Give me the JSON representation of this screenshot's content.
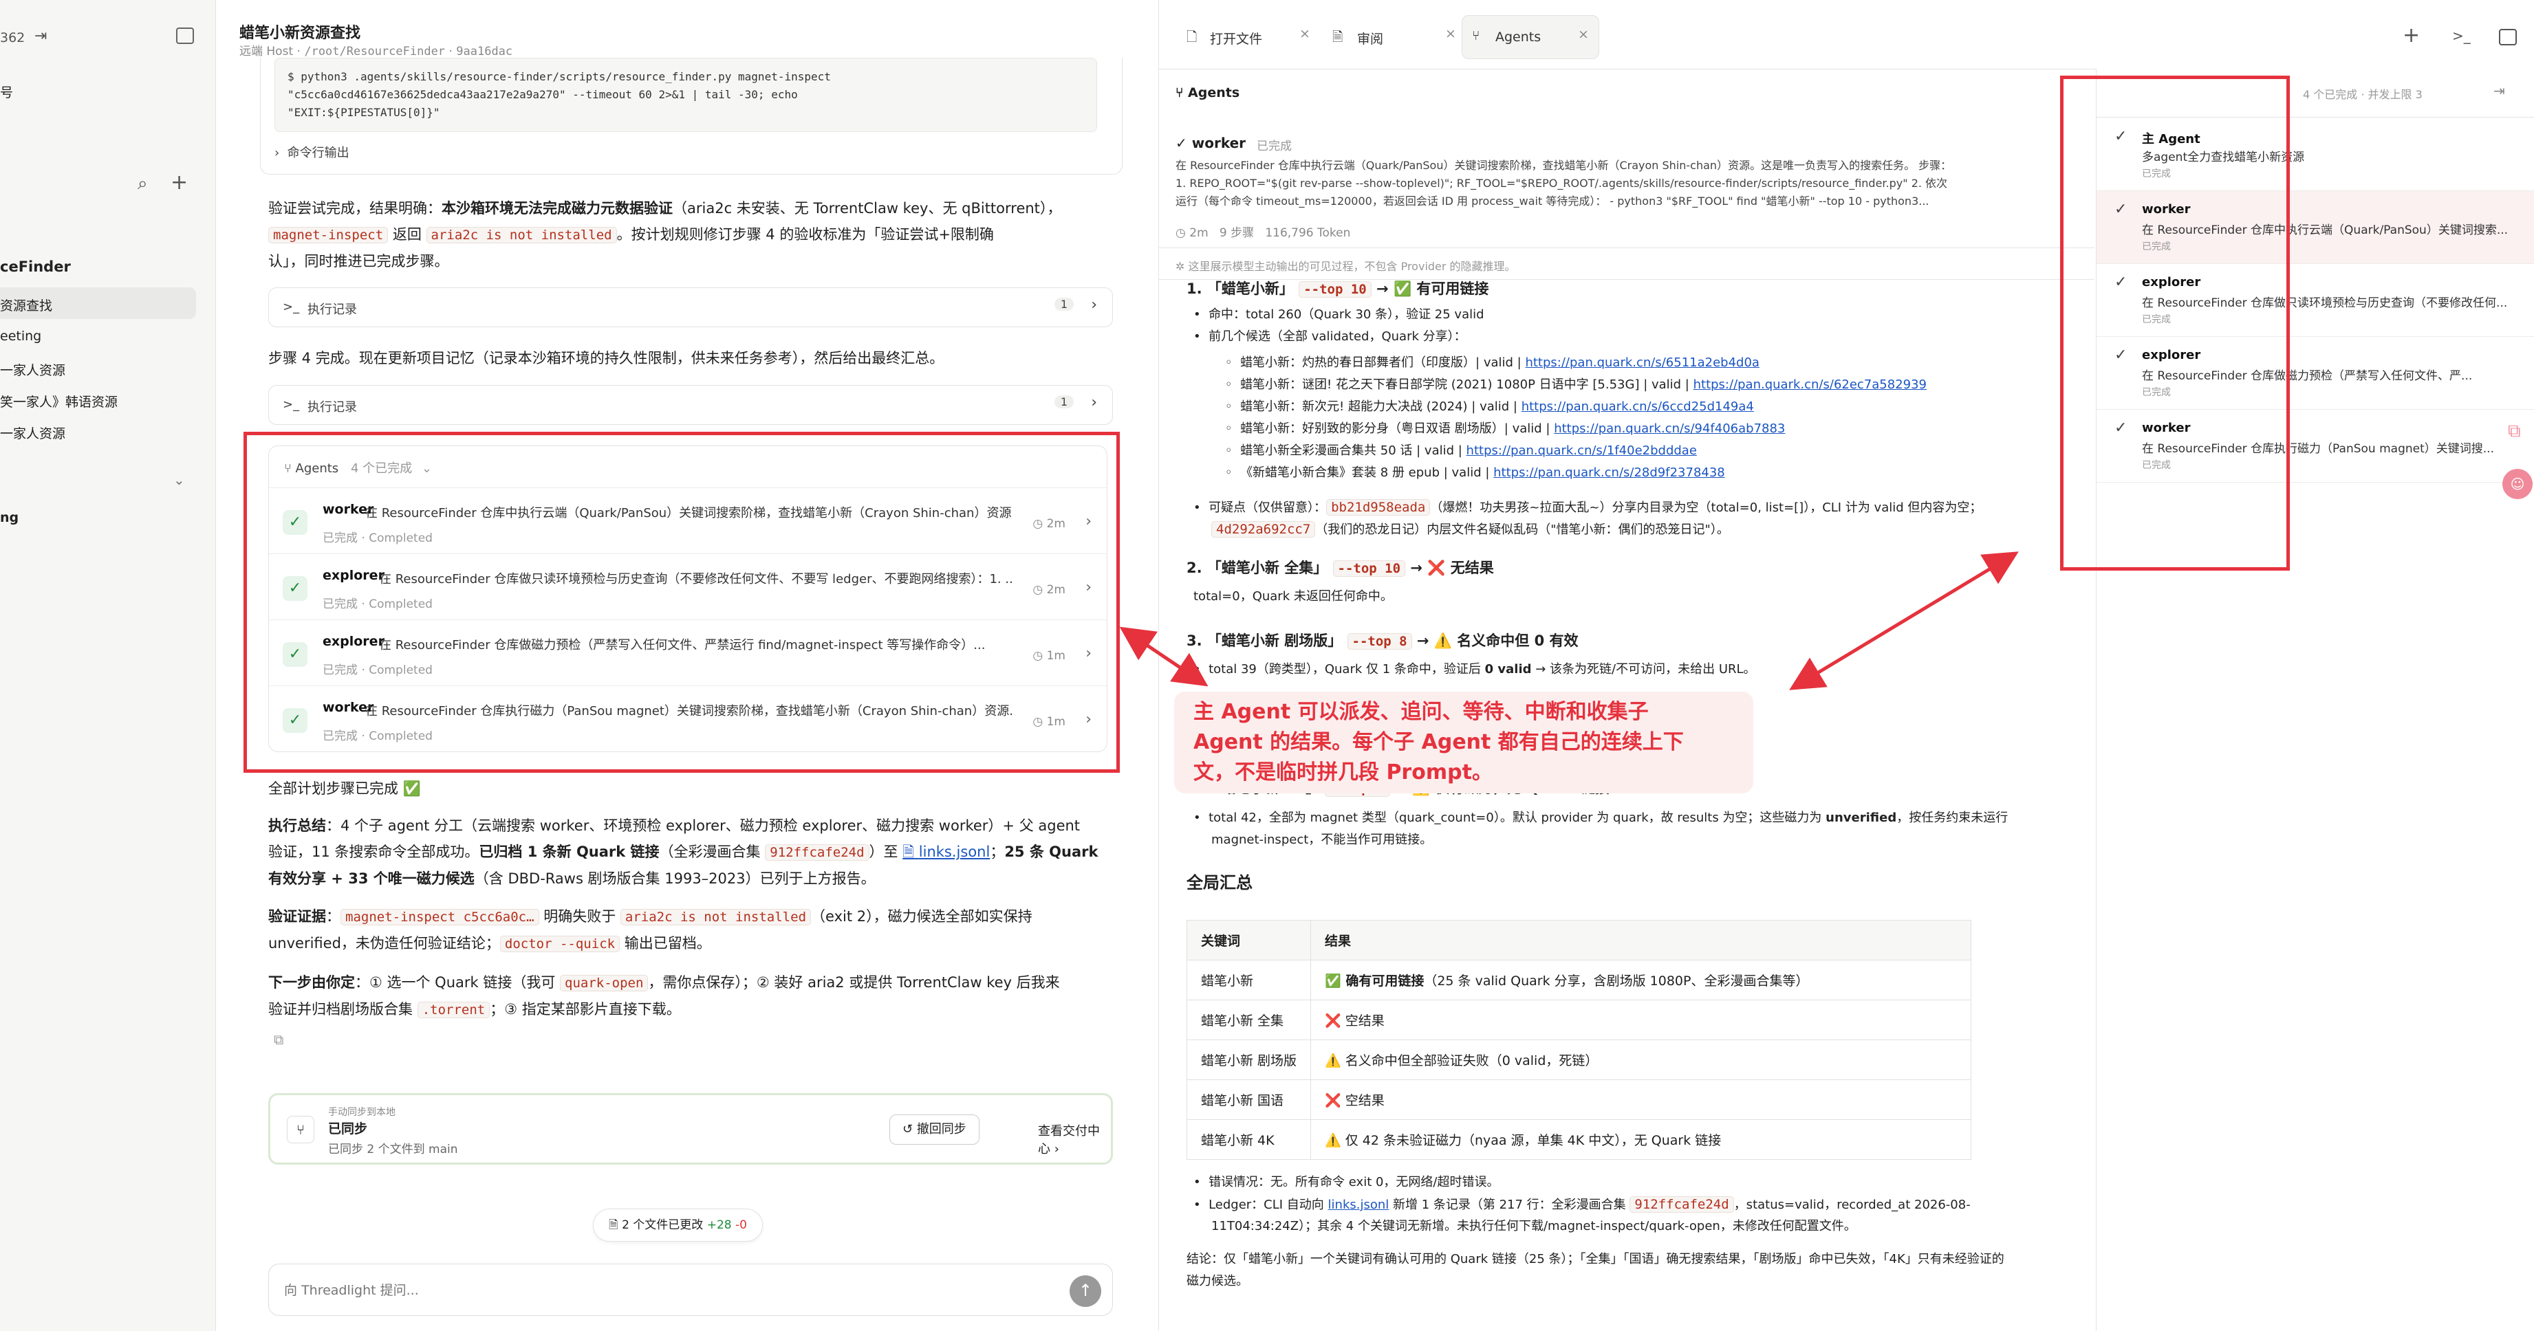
{
  "sidebar": {
    "top_label": "362",
    "frag1": "号",
    "frag_finder": "ceFinder",
    "items": [
      "资源查找",
      "eeting",
      "一家人资源",
      "笑一家人》韩语资源",
      "一家人资源"
    ],
    "frag_ng": "ng"
  },
  "header": {
    "title": "蜡笔小新资源查找",
    "host": "远端 Host",
    "path": "/root/ResourceFinder",
    "hash": "9aa16dac"
  },
  "chat": {
    "cmd_lines": [
      "$ python3 .agents/skills/resource-finder/scripts/resource_finder.py magnet-inspect",
      "\"c5cc6a0cd46167e36625dedca43aa217e2a9a270\" --timeout 60 2>&1 | tail -30; echo",
      "\"EXIT:${PIPESTATUS[0]}\""
    ],
    "cmd_output_label": "命令行输出",
    "p1_a": "验证尝试完成，结果明确：",
    "p1_b": "本沙箱环境无法完成磁力元数据验证",
    "p1_c": "（aria2c 未安装、无 TorrentClaw key、无 qBittorrent），",
    "p1_chip1": "magnet-inspect",
    "p1_d": " 返回 ",
    "p1_chip2": "aria2c is not installed",
    "p1_e": "。按计划规则修订步骤 4 的验收标准为「验证尝试+限制确",
    "p1_f": "认」，同时推进已完成步骤。",
    "exec_label": "执行记录",
    "exec_count": "1",
    "p2": "步骤 4 完成。现在更新项目记忆（记录本沙箱环境的持久性限制，供未来任务参考），然后给出最终汇总。",
    "exec_label2": "执行记录",
    "exec_count2": "1",
    "agents_title": "Agents",
    "agents_count": "4 个已完成",
    "agents": [
      {
        "name": "worker",
        "desc": "在 ResourceFinder 仓库中执行云端（Quark/PanSou）关键词搜索阶梯，查找蜡笔小新（Crayon Shin-chan）资源...",
        "status_cn": "已完成",
        "status_en": "Completed",
        "time": "2m"
      },
      {
        "name": "explorer",
        "desc": "在 ResourceFinder 仓库做只读环境预检与历史查询（不要修改任何文件、不要写 ledger、不要跑网络搜索）：1. ...",
        "status_cn": "已完成",
        "status_en": "Completed",
        "time": "2m"
      },
      {
        "name": "explorer",
        "desc": "在 ResourceFinder 仓库做磁力预检（严禁写入任何文件、严禁运行 find/magnet-inspect 等写操作命令）...",
        "status_cn": "已完成",
        "status_en": "Completed",
        "time": "1m"
      },
      {
        "name": "worker",
        "desc": "在 ResourceFinder 仓库执行磁力（PanSou magnet）关键词搜索阶梯，查找蜡笔小新（Crayon Shin-chan）资源...",
        "status_cn": "已完成",
        "status_en": "Completed",
        "time": "1m"
      }
    ],
    "done_line": "全部计划步骤已完成 ✅",
    "sum_a": "执行总结",
    "sum_b": "：4 个子 agent 分工（云端搜索 worker、环境预检 explorer、磁力预检 explorer、磁力搜索 worker）+ 父 agent",
    "sum_c": "验证，11 条搜索命令全部成功。",
    "sum_d": "已归档 1 条新 Quark 链接",
    "sum_e": "（全彩漫画合集 ",
    "sum_chip": "912ffcafe24d",
    "sum_f": "）至 ",
    "sum_link": "links.jsonl",
    "sum_g": "；",
    "sum_h": "25 条 Quark",
    "sum_i": "有效分享 + 33 个唯一磁力候选",
    "sum_j": "（含 DBD-Raws 剧场版合集 1993–2023）已列于上方报告。",
    "ev_a": "验证证据",
    "ev_b": "：",
    "ev_chip1": "magnet-inspect c5cc6a0c…",
    "ev_c": " 明确失败于 ",
    "ev_chip2": "aria2c is not installed",
    "ev_d": "（exit 2），磁力候选全部如实保持",
    "ev_e": "unverified，未伪造任何验证结论；",
    "ev_chip3": "doctor --quick",
    "ev_f": " 输出已留档。",
    "nx_a": "下一步由你定",
    "nx_b": "：① 选一个 Quark 链接（我可 ",
    "nx_chip1": "quark-open",
    "nx_c": "，需你点保存）；② 装好 aria2 或提供 TorrentClaw key 后我来",
    "nx_d": "验证并归档剧场版合集 ",
    "nx_chip2": ".torrent",
    "nx_e": "；③ 指定某部影片直接下载。",
    "sync_small": "手动同步到本地",
    "sync_title": "已同步",
    "sync_sub": "已同步 2 个文件到 main",
    "sync_undo": "撤回同步",
    "sync_view": "查看交付中心",
    "files_changed": "2 个文件已更改",
    "files_add": "+28",
    "files_del": "-0",
    "input_placeholder": "向 Threadlight 提问..."
  },
  "tabs": [
    {
      "label": "打开文件"
    },
    {
      "label": "审阅"
    },
    {
      "label": "Agents"
    }
  ],
  "rpanel": {
    "title": "Agents",
    "worker_name": "worker",
    "worker_status": "已完成",
    "prompt_lines": [
      "在 ResourceFinder 仓库中执行云端（Quark/PanSou）关键词搜索阶梯，查找蜡笔小新（Crayon Shin-chan）资源。这是唯一负责写入的搜索任务。 步骤：",
      "1. REPO_ROOT=\"$(git rev-parse --show-toplevel)\"; RF_TOOL=\"$REPO_ROOT/.agents/skills/resource-finder/scripts/resource_finder.py\" 2. 依次",
      "运行（每个命令 timeout_ms=120000，若返回会话 ID 用 process_wait 等待完成）： - python3 \"$RF_TOOL\" find \"蜡笔小新\" --top 10 - python3..."
    ],
    "meta_time": "2m",
    "meta_steps": "9 步骤",
    "meta_tokens": "116,796 Token",
    "notice": "这里展示模型主动输出的可见过程，不包含 Provider 的隐藏推理。",
    "h1_a": "1. 「蜡笔小新」",
    "h1_chip": "--top 10",
    "h1_b": "→ ✅ 有可用链接",
    "b1": "命中：total 260（Quark 30 条），验证 25 valid",
    "b2": "前几个候选（全部 validated，Quark 分享）：",
    "links": [
      {
        "pre": "蜡笔小新：灼热的春日部舞者们（印度版）| valid | ",
        "url": "https://pan.quark.cn/s/6511a2eb4d0a"
      },
      {
        "pre": "蜡笔小新：谜团! 花之天下春日部学院 (2021) 1080P 日语中字 [5.53G] | valid | ",
        "url": "https://pan.quark.cn/s/62ec7a582939"
      },
      {
        "pre": "蜡笔小新：新次元! 超能力大决战 (2024) | valid | ",
        "url": "https://pan.quark.cn/s/6ccd25d149a4"
      },
      {
        "pre": "蜡笔小新：好别致的影分身（粤日双语 剧场版）| valid | ",
        "url": "https://pan.quark.cn/s/94f406ab7883"
      },
      {
        "pre": "蜡笔小新全彩漫画合集共 50 话 | valid | ",
        "url": "https://pan.quark.cn/s/1f40e2bdddae"
      },
      {
        "pre": "《新蜡笔小新合集》套装 8 册 epub | valid | ",
        "url": "https://pan.quark.cn/s/28d9f2378438"
      }
    ],
    "q_a": "可疑点（仅供留意）：",
    "q_chip1": "bb21d958eada",
    "q_b": "（爆燃！功夫男孩~拉面大乱~）分享内目录为空（total=0, list=[]），CLI 计为 valid 但内容为空；",
    "q_chip2": "4d292a692cc7",
    "q_c": "（我们的恐龙日记）内层文件名疑似乱码（\"惜笔小新：偶们的恐笼日记\"）。",
    "h2_a": "2. 「蜡笔小新 全集」",
    "h2_chip": "--top 10",
    "h2_b": "→ ❌ 无结果",
    "h2_text": "total=0，Quark 未返回任何命中。",
    "h3_a": "3. 「蜡笔小新 剧场版」",
    "h3_chip": "--top 8",
    "h3_b": "→ ⚠️ 名义命中但 0 有效",
    "h3_text_a": "total 39（跨类型），Quark 仅 1 条命中，验证后 ",
    "h3_text_b": "0 valid",
    "h3_text_c": " → 该条为死链/不可访问，未给出 URL。",
    "h4": "4.",
    "h5_a": "5. 「蜡笔小新 4K」",
    "h5_chip": "--top 8",
    "h5_b": "→ ⚠️ 仅有磁力，无 Quark 链接",
    "h5_t1a": "total 42，全部为 magnet 类型（quark_count=0）。默认 provider 为 quark，故 results 为空；这些磁力为 ",
    "h5_t1b": "unverified",
    "h5_t1c": "，按任务约束未运行",
    "h5_t2": "magnet-inspect，不能当作可用链接。",
    "summary_title": "全局汇总",
    "table_head": [
      "关键词",
      "结果"
    ],
    "table_rows": [
      [
        "蜡笔小新",
        "✅ 确有可用链接",
        "（25 条 valid Quark 分享，含剧场版 1080P、全彩漫画合集等）"
      ],
      [
        "蜡笔小新 全集",
        "❌ 空结果",
        ""
      ],
      [
        "蜡笔小新 剧场版",
        "⚠️ 名义命中但全部验证失败（0 valid，死链）",
        ""
      ],
      [
        "蜡笔小新 国语",
        "❌ 空结果",
        ""
      ],
      [
        "蜡笔小新 4K",
        "⚠️ 仅 42 条未验证磁力（nyaa 源，单集 4K 中文），无 Quark 链接",
        ""
      ]
    ],
    "err_line": "错误情况：无。所有命令 exit 0，无网络/超时错误。",
    "ledger_a": "Ledger：CLI 自动向 ",
    "ledger_link": "links.jsonl",
    "ledger_b": " 新增 1 条记录（第 217 行：全彩漫画合集 ",
    "ledger_chip": "912ffcafe24d",
    "ledger_c": "，status=valid，recorded_at 2026-08-",
    "ledger_d": "11T04:34:24Z）；其余 4 个关键词无新增。未执行任何下载/magnet-inspect/quark-open，未修改任何配置文件。",
    "concl1": "结论：仅「蜡笔小新」一个关键词有确认可用的 Quark 链接（25 条）；「全集」「国语」确无搜索结果，「剧场版」命中已失效，「4K」只有未经验证的",
    "concl2": "磁力候选。"
  },
  "pane": {
    "header": "4 个已完成 · 并发上限 3",
    "items": [
      {
        "name": "主 Agent",
        "desc": "多agent全力查找蜡笔小新资源",
        "status": "已完成"
      },
      {
        "name": "worker",
        "desc": "在 ResourceFinder 仓库中执行云端（Quark/PanSou）关键词搜索...",
        "status": "已完成"
      },
      {
        "name": "explorer",
        "desc": "在 ResourceFinder 仓库做只读环境预检与历史查询（不要修改任何...",
        "status": "已完成"
      },
      {
        "name": "explorer",
        "desc": "在 ResourceFinder 仓库做磁力预检（严禁写入任何文件、严...",
        "status": "已完成"
      },
      {
        "name": "worker",
        "desc": "在 ResourceFinder 仓库执行磁力（PanSou magnet）关键词搜...",
        "status": "已完成"
      }
    ]
  },
  "annotation": {
    "line1": "主 Agent 可以派发、追问、等待、中断和收集子",
    "line2": "Agent 的结果。每个子 Agent 都有自己的连续上下",
    "line3": "文，不是临时拼几段 Prompt。"
  },
  "colors": {
    "accent_red": "#e5323d",
    "link": "#1a55c2",
    "chip_text": "#b5311d",
    "success": "#1f8a3b"
  }
}
